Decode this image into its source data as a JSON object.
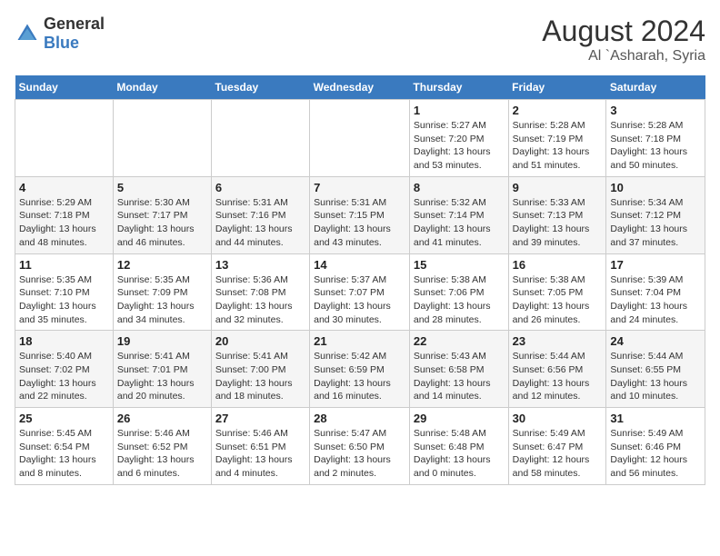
{
  "logo": {
    "general": "General",
    "blue": "Blue"
  },
  "title": {
    "month_year": "August 2024",
    "location": "Al `Asharah, Syria"
  },
  "days_header": [
    "Sunday",
    "Monday",
    "Tuesday",
    "Wednesday",
    "Thursday",
    "Friday",
    "Saturday"
  ],
  "weeks": [
    [
      {
        "day": "",
        "content": ""
      },
      {
        "day": "",
        "content": ""
      },
      {
        "day": "",
        "content": ""
      },
      {
        "day": "",
        "content": ""
      },
      {
        "day": "1",
        "content": "Sunrise: 5:27 AM\nSunset: 7:20 PM\nDaylight: 13 hours and 53 minutes."
      },
      {
        "day": "2",
        "content": "Sunrise: 5:28 AM\nSunset: 7:19 PM\nDaylight: 13 hours and 51 minutes."
      },
      {
        "day": "3",
        "content": "Sunrise: 5:28 AM\nSunset: 7:18 PM\nDaylight: 13 hours and 50 minutes."
      }
    ],
    [
      {
        "day": "4",
        "content": "Sunrise: 5:29 AM\nSunset: 7:18 PM\nDaylight: 13 hours and 48 minutes."
      },
      {
        "day": "5",
        "content": "Sunrise: 5:30 AM\nSunset: 7:17 PM\nDaylight: 13 hours and 46 minutes."
      },
      {
        "day": "6",
        "content": "Sunrise: 5:31 AM\nSunset: 7:16 PM\nDaylight: 13 hours and 44 minutes."
      },
      {
        "day": "7",
        "content": "Sunrise: 5:31 AM\nSunset: 7:15 PM\nDaylight: 13 hours and 43 minutes."
      },
      {
        "day": "8",
        "content": "Sunrise: 5:32 AM\nSunset: 7:14 PM\nDaylight: 13 hours and 41 minutes."
      },
      {
        "day": "9",
        "content": "Sunrise: 5:33 AM\nSunset: 7:13 PM\nDaylight: 13 hours and 39 minutes."
      },
      {
        "day": "10",
        "content": "Sunrise: 5:34 AM\nSunset: 7:12 PM\nDaylight: 13 hours and 37 minutes."
      }
    ],
    [
      {
        "day": "11",
        "content": "Sunrise: 5:35 AM\nSunset: 7:10 PM\nDaylight: 13 hours and 35 minutes."
      },
      {
        "day": "12",
        "content": "Sunrise: 5:35 AM\nSunset: 7:09 PM\nDaylight: 13 hours and 34 minutes."
      },
      {
        "day": "13",
        "content": "Sunrise: 5:36 AM\nSunset: 7:08 PM\nDaylight: 13 hours and 32 minutes."
      },
      {
        "day": "14",
        "content": "Sunrise: 5:37 AM\nSunset: 7:07 PM\nDaylight: 13 hours and 30 minutes."
      },
      {
        "day": "15",
        "content": "Sunrise: 5:38 AM\nSunset: 7:06 PM\nDaylight: 13 hours and 28 minutes."
      },
      {
        "day": "16",
        "content": "Sunrise: 5:38 AM\nSunset: 7:05 PM\nDaylight: 13 hours and 26 minutes."
      },
      {
        "day": "17",
        "content": "Sunrise: 5:39 AM\nSunset: 7:04 PM\nDaylight: 13 hours and 24 minutes."
      }
    ],
    [
      {
        "day": "18",
        "content": "Sunrise: 5:40 AM\nSunset: 7:02 PM\nDaylight: 13 hours and 22 minutes."
      },
      {
        "day": "19",
        "content": "Sunrise: 5:41 AM\nSunset: 7:01 PM\nDaylight: 13 hours and 20 minutes."
      },
      {
        "day": "20",
        "content": "Sunrise: 5:41 AM\nSunset: 7:00 PM\nDaylight: 13 hours and 18 minutes."
      },
      {
        "day": "21",
        "content": "Sunrise: 5:42 AM\nSunset: 6:59 PM\nDaylight: 13 hours and 16 minutes."
      },
      {
        "day": "22",
        "content": "Sunrise: 5:43 AM\nSunset: 6:58 PM\nDaylight: 13 hours and 14 minutes."
      },
      {
        "day": "23",
        "content": "Sunrise: 5:44 AM\nSunset: 6:56 PM\nDaylight: 13 hours and 12 minutes."
      },
      {
        "day": "24",
        "content": "Sunrise: 5:44 AM\nSunset: 6:55 PM\nDaylight: 13 hours and 10 minutes."
      }
    ],
    [
      {
        "day": "25",
        "content": "Sunrise: 5:45 AM\nSunset: 6:54 PM\nDaylight: 13 hours and 8 minutes."
      },
      {
        "day": "26",
        "content": "Sunrise: 5:46 AM\nSunset: 6:52 PM\nDaylight: 13 hours and 6 minutes."
      },
      {
        "day": "27",
        "content": "Sunrise: 5:46 AM\nSunset: 6:51 PM\nDaylight: 13 hours and 4 minutes."
      },
      {
        "day": "28",
        "content": "Sunrise: 5:47 AM\nSunset: 6:50 PM\nDaylight: 13 hours and 2 minutes."
      },
      {
        "day": "29",
        "content": "Sunrise: 5:48 AM\nSunset: 6:48 PM\nDaylight: 13 hours and 0 minutes."
      },
      {
        "day": "30",
        "content": "Sunrise: 5:49 AM\nSunset: 6:47 PM\nDaylight: 12 hours and 58 minutes."
      },
      {
        "day": "31",
        "content": "Sunrise: 5:49 AM\nSunset: 6:46 PM\nDaylight: 12 hours and 56 minutes."
      }
    ]
  ]
}
